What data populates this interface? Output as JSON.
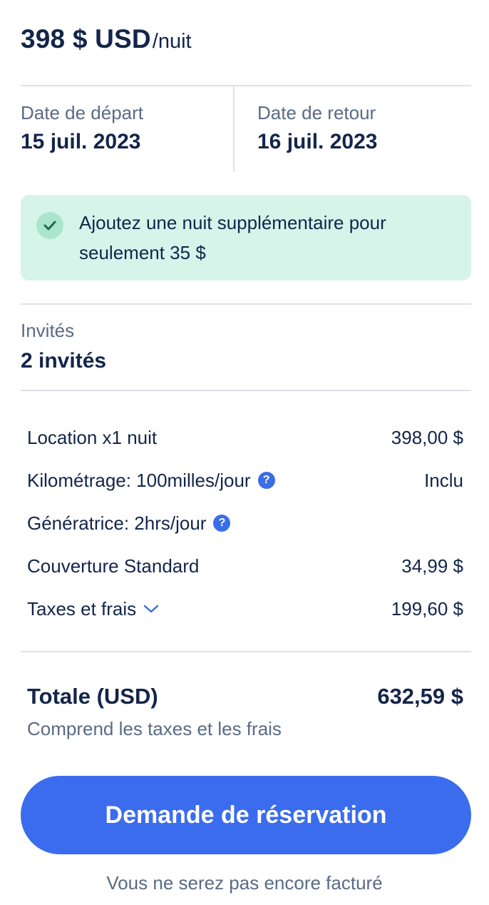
{
  "price": {
    "amount": "398 $ USD",
    "unit": "/nuit"
  },
  "dates": {
    "departure": {
      "label": "Date de départ",
      "value": "15 juil. 2023"
    },
    "return": {
      "label": "Date de retour",
      "value": "16 juil. 2023"
    }
  },
  "promo": {
    "text": "Ajoutez une nuit supplémentaire pour seulement 35 $",
    "icon": "check-icon",
    "bg_color": "#d6f4ea"
  },
  "guests": {
    "label": "Invités",
    "value": "2 invités"
  },
  "breakdown": {
    "rows": [
      {
        "label": "Location x1 nuit",
        "value": "398,00 $"
      },
      {
        "label": "Kilométrage: 100milles/jour",
        "value": "Inclu",
        "icon": "help-icon"
      },
      {
        "label": "Génératrice: 2hrs/jour",
        "value": "",
        "icon": "help-icon"
      },
      {
        "label": "Couverture Standard",
        "value": "34,99 $"
      },
      {
        "label": "Taxes et frais",
        "value": "199,60 $",
        "icon": "chevron-down-icon"
      }
    ]
  },
  "total": {
    "label": "Totale (USD)",
    "value": "632,59 $",
    "note": "Comprend les taxes et les frais"
  },
  "cta": {
    "label": "Demande de réservation",
    "color": "#3b6ced"
  },
  "footnote": "Vous ne serez pas encore facturé"
}
